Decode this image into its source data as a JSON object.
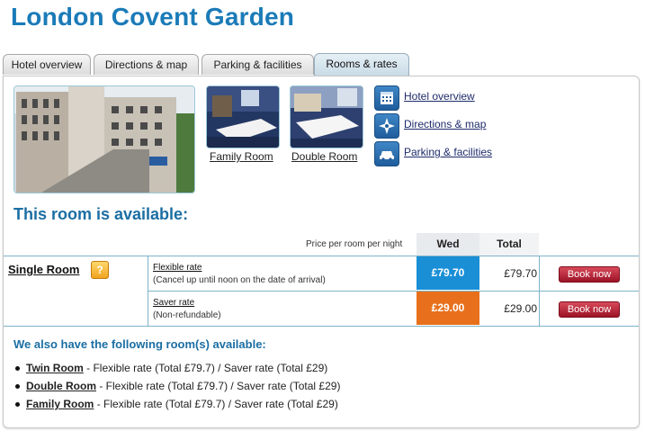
{
  "page": {
    "title": "London Covent Garden"
  },
  "tabs": [
    {
      "label": "Hotel overview",
      "active": false
    },
    {
      "label": "Directions & map",
      "active": false
    },
    {
      "label": "Parking & facilities",
      "active": false
    },
    {
      "label": "Rooms & rates",
      "active": true
    }
  ],
  "photos": {
    "family_label": "Family Room",
    "double_label": "Double Room"
  },
  "side_links": [
    {
      "label": "Hotel overview",
      "icon": "calendar-icon"
    },
    {
      "label": "Directions & map",
      "icon": "compass-icon"
    },
    {
      "label": "Parking & facilities",
      "icon": "car-icon"
    }
  ],
  "availability": {
    "heading": "This room is available:",
    "price_header": "Price per room per night",
    "col_day": "Wed",
    "col_total": "Total",
    "room_name": "Single Room",
    "help_glyph": "?",
    "rates": [
      {
        "name": "Flexible rate",
        "desc": "(Cancel up until noon on the date of arrival)",
        "price": "£79.70",
        "total": "£79.70",
        "color": "#1a8fd6",
        "button": "Book now"
      },
      {
        "name": "Saver rate",
        "desc": "(Non-refundable)",
        "price": "£29.00",
        "total": "£29.00",
        "color": "#e8701c",
        "button": "Book now"
      }
    ]
  },
  "others": {
    "heading": "We also have the following room(s) available:",
    "items": [
      {
        "room": "Twin Room",
        "text": " - Flexible rate (Total £79.7) / Saver rate (Total £29)"
      },
      {
        "room": "Double Room",
        "text": " - Flexible rate (Total £79.7) / Saver rate (Total £29)"
      },
      {
        "room": "Family Room",
        "text": " - Flexible rate (Total £79.7) / Saver rate (Total £29)"
      }
    ]
  },
  "colors": {
    "brand": "#1b7bb8",
    "flexible": "#1a8fd6",
    "saver": "#e8701c",
    "book": "#b01c30"
  }
}
